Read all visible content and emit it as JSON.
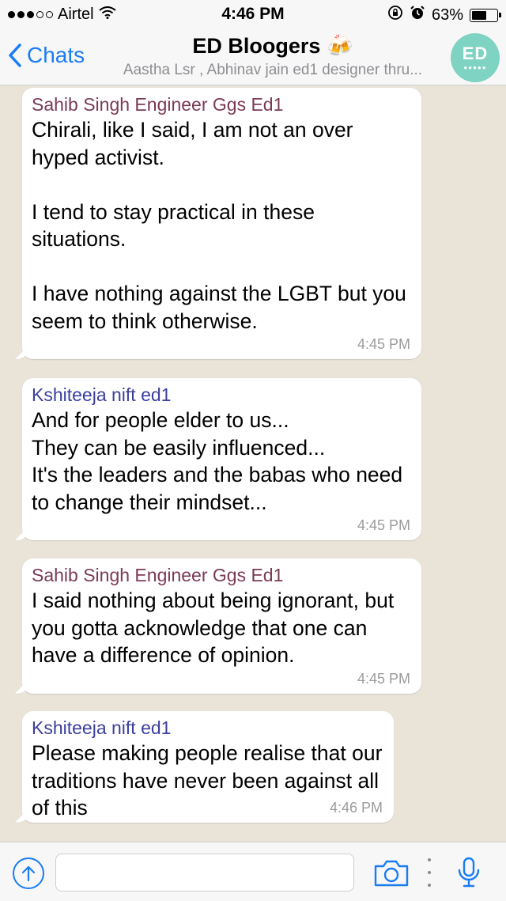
{
  "status_bar": {
    "carrier": "Airtel",
    "time": "4:46 PM",
    "battery": "63%",
    "battery_level": 0.63
  },
  "nav": {
    "back_label": "Chats",
    "title": "ED Bloogers 🍻",
    "subtitle": "Aastha Lsr , Abhinav jain ed1 designer thru...",
    "avatar_text": "ED",
    "avatar_dots": "●●●●●"
  },
  "messages": [
    {
      "sender": "Sahib Singh Engineer Ggs Ed1",
      "text": "Chirali, like I said, I am not an over hyped activist.\n\nI tend to stay practical in these situations.\n\nI have nothing against the LGBT but you seem to think otherwise.",
      "time": "4:45 PM"
    },
    {
      "sender": "Kshiteeja nift ed1",
      "text": "And for people elder to us...\nThey can be easily influenced...\nIt's the leaders and the babas who need to change their mindset...",
      "time": "4:45 PM"
    },
    {
      "sender": "Sahib Singh Engineer Ggs Ed1",
      "text": "I said nothing about being ignorant, but you gotta acknowledge that one can have a difference of opinion.",
      "time": "4:45 PM"
    },
    {
      "sender": "Kshiteeja nift ed1",
      "text": "Please making people realise that our traditions have never been against all of this",
      "time": "4:46 PM"
    }
  ],
  "input": {
    "value": "",
    "placeholder": ""
  },
  "colors": {
    "accent": "#1a7cf5",
    "sender_sahib": "#7b3a56",
    "sender_kshiteeja": "#3b3f9c",
    "chat_background": "#e9e3d8"
  },
  "icons": [
    "wifi-icon",
    "orientation-lock-icon",
    "alarm-icon",
    "battery-icon",
    "back-chevron-icon",
    "upload-icon",
    "camera-icon",
    "more-icon",
    "microphone-icon"
  ]
}
